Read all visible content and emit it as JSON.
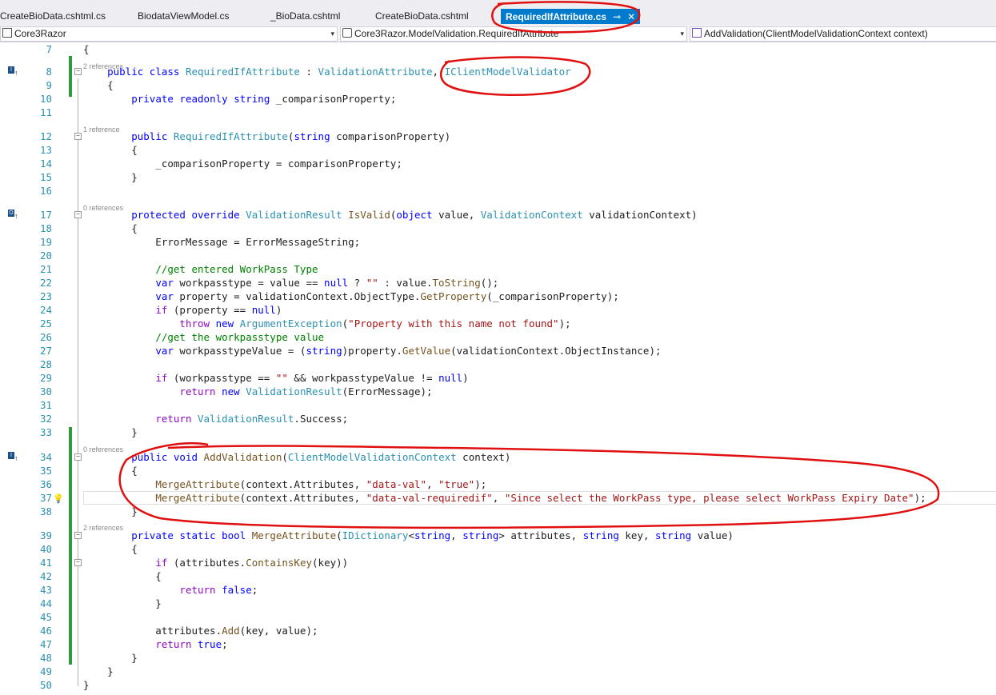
{
  "tabs": [
    {
      "label": "CreateBioData.cshtml.cs"
    },
    {
      "label": "BiodataViewModel.cs"
    },
    {
      "label": "_BioData.cshtml"
    },
    {
      "label": "CreateBioData.cshtml"
    },
    {
      "label": "RequiredIfAttribute.cs",
      "active": true,
      "pin_glyph": "⊸",
      "close_glyph": "✕"
    }
  ],
  "navbar": {
    "project": "Core3Razor",
    "type": "Core3Razor.ModelValidation.RequiredIfAttribute",
    "member": "AddValidation(ClientModelValidationContext context)",
    "dropdown_glyph": "▾"
  },
  "icons": {
    "project_icon": "csharp-project-icon",
    "type_icon": "class-icon",
    "member_icon": "method-cube-icon",
    "fold_icon": "collapse-minus-icon",
    "bulb_icon": "lightbulb-icon"
  },
  "colors": {
    "keyword": "#0000ff",
    "type": "#2b91af",
    "string": "#a31515",
    "comment": "#008000",
    "method": "#74531f",
    "control": "#8f08c4",
    "active_tab": "#007acc",
    "annotation": "#e01010",
    "changed_bar": "#2e9b3e"
  },
  "refs": {
    "l8": "2 references",
    "l12": "1 reference",
    "l17": "0 references",
    "l34": "0 references",
    "l39": "2 references"
  },
  "gutter": {
    "l8": "↑",
    "l17": "↑",
    "l34": "↑",
    "l8_box": "I",
    "l17_box": "O",
    "l34_box": "I"
  },
  "lines": {
    "n7": "7",
    "n8": "8",
    "n9": "9",
    "n10": "10",
    "n11": "11",
    "n12": "12",
    "n13": "13",
    "n14": "14",
    "n15": "15",
    "n16": "16",
    "n17": "17",
    "n18": "18",
    "n19": "19",
    "n20": "20",
    "n21": "21",
    "n22": "22",
    "n23": "23",
    "n24": "24",
    "n25": "25",
    "n26": "26",
    "n27": "27",
    "n28": "28",
    "n29": "29",
    "n30": "30",
    "n31": "31",
    "n32": "32",
    "n33": "33",
    "n34": "34",
    "n35": "35",
    "n36": "36",
    "n37": "37",
    "n38": "38",
    "n39": "39",
    "n40": "40",
    "n41": "41",
    "n42": "42",
    "n43": "43",
    "n44": "44",
    "n45": "45",
    "n46": "46",
    "n47": "47",
    "n48": "48",
    "n49": "49",
    "n50": "50"
  },
  "code": {
    "l7": "{",
    "l8": [
      "    ",
      "public",
      " ",
      "class",
      " ",
      "RequiredIfAttribute",
      " : ",
      "ValidationAttribute",
      ", ",
      "IClientModelValidator"
    ],
    "l9": "    {",
    "l10": [
      "        ",
      "private",
      " ",
      "readonly",
      " ",
      "string",
      " _comparisonProperty;"
    ],
    "l12": [
      "        ",
      "public",
      " ",
      "RequiredIfAttribute",
      "(",
      "string",
      " comparisonProperty)"
    ],
    "l13": "        {",
    "l14": "            _comparisonProperty = comparisonProperty;",
    "l15": "        }",
    "l17": [
      "        ",
      "protected",
      " ",
      "override",
      " ",
      "ValidationResult",
      " ",
      "IsValid",
      "(",
      "object",
      " value, ",
      "ValidationContext",
      " validationContext)"
    ],
    "l18": "        {",
    "l19": "            ErrorMessage = ErrorMessageString;",
    "l21": [
      "            ",
      "//get entered WorkPass Type"
    ],
    "l22": [
      "            ",
      "var",
      " workpasstype = value == ",
      "null",
      " ? ",
      "\"\"",
      " : value.",
      "ToString",
      "();"
    ],
    "l23": [
      "            ",
      "var",
      " property = validationContext.ObjectType.",
      "GetProperty",
      "(_comparisonProperty);"
    ],
    "l24": [
      "            ",
      "if",
      " (property == ",
      "null",
      ")"
    ],
    "l25": [
      "                ",
      "throw",
      " ",
      "new",
      " ",
      "ArgumentException",
      "(",
      "\"Property with this name not found\"",
      ");"
    ],
    "l26": [
      "            ",
      "//get the workpasstype value"
    ],
    "l27": [
      "            ",
      "var",
      " workpasstypeValue = (",
      "string",
      ")property.",
      "GetValue",
      "(validationContext.ObjectInstance);"
    ],
    "l29": [
      "            ",
      "if",
      " (workpasstype == ",
      "\"\"",
      " && workpasstypeValue != ",
      "null",
      ")"
    ],
    "l30": [
      "                ",
      "return",
      " ",
      "new",
      " ",
      "ValidationResult",
      "(ErrorMessage);"
    ],
    "l32": [
      "            ",
      "return",
      " ",
      "ValidationResult",
      ".Success;"
    ],
    "l33": "        }",
    "l34": [
      "        ",
      "public",
      " ",
      "void",
      " ",
      "AddValidation",
      "(",
      "ClientModelValidationContext",
      " context)"
    ],
    "l35": "        {",
    "l36": [
      "            ",
      "MergeAttribute",
      "(context.Attributes, ",
      "\"data-val\"",
      ", ",
      "\"true\"",
      ");"
    ],
    "l37": [
      "            ",
      "MergeAttribute",
      "(context.Attributes, ",
      "\"data-val-requiredif\"",
      ", ",
      "\"Since select the WorkPass type, please select WorkPass Expiry Date\"",
      ");"
    ],
    "l38": "        }",
    "l39": [
      "        ",
      "private",
      " ",
      "static",
      " ",
      "bool",
      " ",
      "MergeAttribute",
      "(",
      "IDictionary",
      "<",
      "string",
      ", ",
      "string",
      "> attributes, ",
      "string",
      " key, ",
      "string",
      " value)"
    ],
    "l40": "        {",
    "l41": [
      "            ",
      "if",
      " (attributes.",
      "ContainsKey",
      "(key))"
    ],
    "l42": "            {",
    "l43": [
      "                ",
      "return",
      " ",
      "false",
      ";"
    ],
    "l44": "            }",
    "l46": [
      "            attributes.",
      "Add",
      "(key, value);"
    ],
    "l47": [
      "            ",
      "return",
      " ",
      "true",
      ";"
    ],
    "l48": "        }",
    "l49": "    }",
    "l50": "}"
  }
}
